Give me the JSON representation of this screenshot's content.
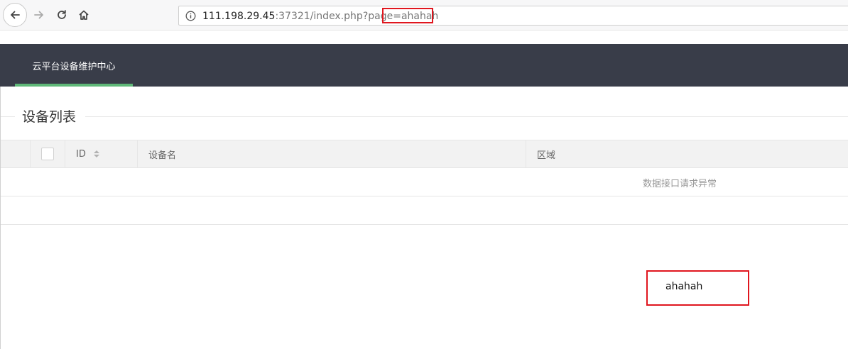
{
  "browser": {
    "url_host": "111.198.29.45",
    "url_port": ":37321",
    "url_path": "/index.php?page=",
    "url_query_value": "ahahah",
    "icons": [
      "back-arrow-icon",
      "forward-arrow-icon",
      "reload-icon",
      "home-icon",
      "info-icon"
    ]
  },
  "app": {
    "nav_title": "云平台设备维护中心",
    "accent_color": "#5fb878",
    "header_color": "#393d49"
  },
  "section": {
    "title": "设备列表"
  },
  "table": {
    "columns": [
      "ID",
      "设备名",
      "区域"
    ],
    "empty_message": "数据接口请求异常"
  },
  "echo_output": "ahahah",
  "annotation_color": "#e0161e"
}
